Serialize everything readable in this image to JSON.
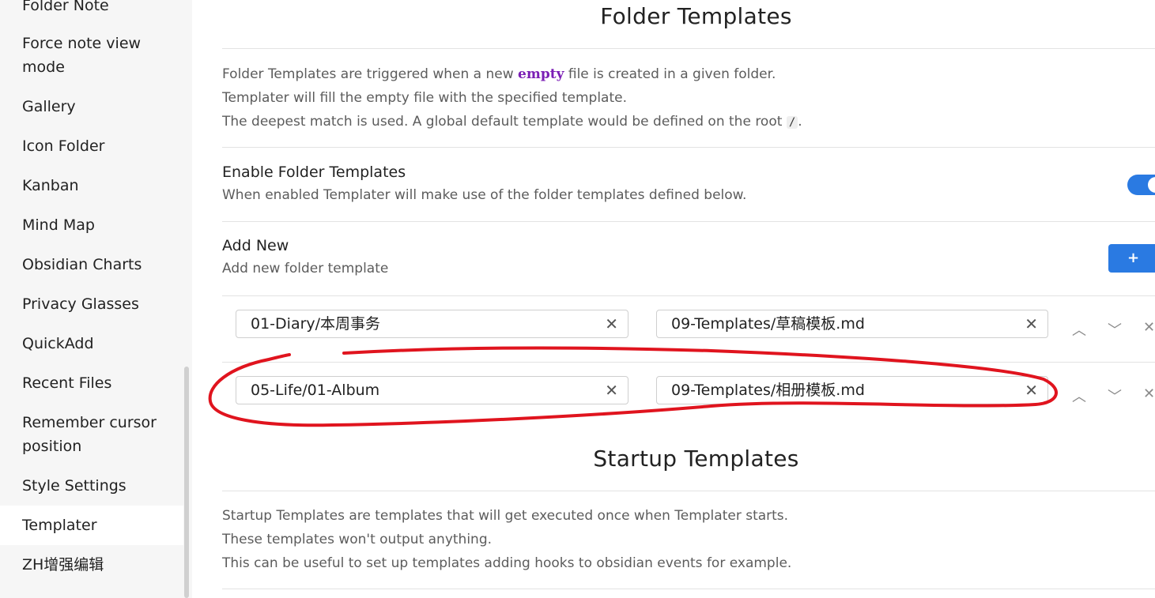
{
  "sidebar": {
    "items": [
      {
        "label": "Folder Note"
      },
      {
        "label": "Force note view"
      },
      {
        "label": "mode"
      },
      {
        "label": "Gallery"
      },
      {
        "label": "Icon Folder"
      },
      {
        "label": "Kanban"
      },
      {
        "label": "Mind Map"
      },
      {
        "label": "Obsidian Charts"
      },
      {
        "label": "Privacy Glasses"
      },
      {
        "label": "QuickAdd"
      },
      {
        "label": "Recent Files"
      },
      {
        "label": "Remember cursor"
      },
      {
        "label": "position"
      },
      {
        "label": "Style Settings"
      },
      {
        "label": "Templater"
      },
      {
        "label": "ZH增强编辑"
      }
    ]
  },
  "folder_templates": {
    "title": "Folder Templates",
    "desc1_a": "Folder Templates are triggered when a new ",
    "desc1_kw": "empty",
    "desc1_b": " file is created in a given folder.",
    "desc2": "Templater will fill the empty file with the specified template.",
    "desc3_a": "The deepest match is used. A global default template would be defined on the root ",
    "desc3_code": "/",
    "desc3_b": ".",
    "enable": {
      "name": "Enable Folder Templates",
      "desc": "When enabled Templater will make use of the folder templates defined below.",
      "enabled": true
    },
    "add_new": {
      "name": "Add New",
      "desc": "Add new folder template",
      "button": "+"
    },
    "rows": [
      {
        "folder": "01-Diary/本周事务",
        "template": "09-Templates/草稿模板.md"
      },
      {
        "folder": "05-Life/01-Album",
        "template": "09-Templates/相册模板.md"
      }
    ],
    "clear_glyph": "✕",
    "up_glyph": "︿",
    "down_glyph": "﹀",
    "remove_glyph": "✕"
  },
  "startup_templates": {
    "title": "Startup Templates",
    "desc1": "Startup Templates are templates that will get executed once when Templater starts.",
    "desc2": "These templates won't output anything.",
    "desc3": "This can be useful to set up templates adding hooks to obsidian events for example."
  },
  "colors": {
    "accent": "#2a7ae2",
    "annotation": "#e0141e",
    "keyword": "#7b1fb5"
  }
}
